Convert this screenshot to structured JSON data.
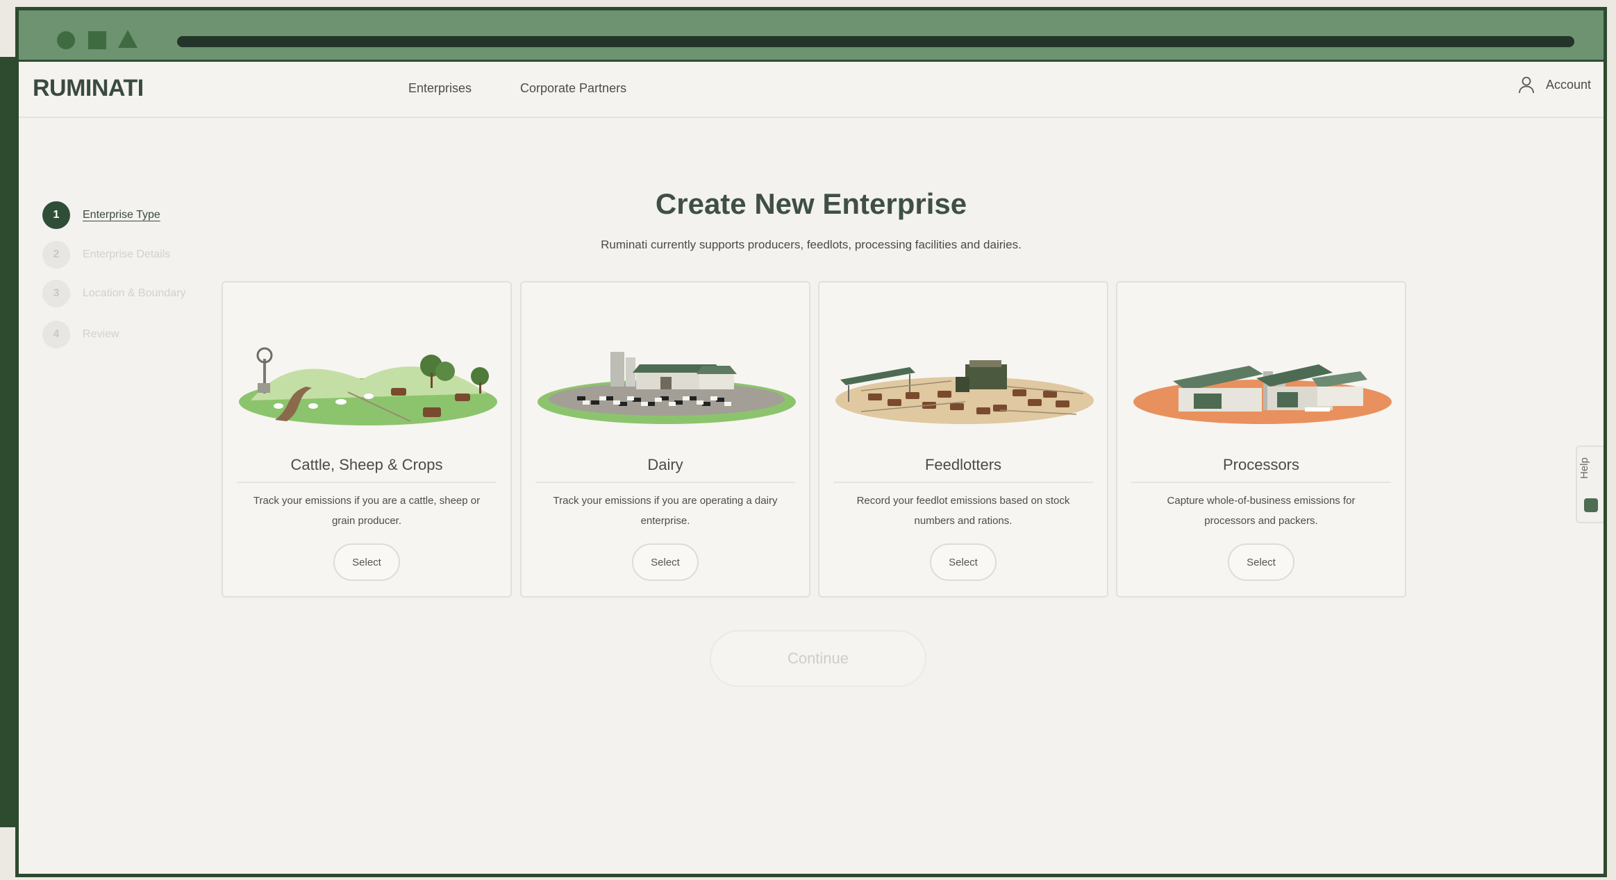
{
  "nav": {
    "logo": "RUMINATI",
    "links": [
      "Enterprises",
      "Corporate Partners"
    ],
    "account_label": "Account"
  },
  "steps": [
    {
      "number": "1",
      "label": "Enterprise Type",
      "state": "active"
    },
    {
      "number": "2",
      "label": "Enterprise Details",
      "state": "inactive"
    },
    {
      "number": "3",
      "label": "Location & Boundary",
      "state": "inactive"
    },
    {
      "number": "4",
      "label": "Review",
      "state": "inactive"
    }
  ],
  "main": {
    "title": "Create New Enterprise",
    "subtitle": "Ruminati currently supports producers, feedlots, processing facilities and dairies."
  },
  "cards": [
    {
      "title": "Cattle, Sheep & Crops",
      "description": "Track your emissions if you are a cattle, sheep or grain producer.",
      "button": "Select",
      "icon": "farm-illustration"
    },
    {
      "title": "Dairy",
      "description": "Track your emissions if you are operating a dairy enterprise.",
      "button": "Select",
      "icon": "dairy-illustration"
    },
    {
      "title": "Feedlotters",
      "description": "Record your feedlot emissions based on stock numbers and rations.",
      "button": "Select",
      "icon": "feedlot-illustration"
    },
    {
      "title": "Processors",
      "description": "Capture whole-of-business emissions for processors and packers.",
      "button": "Select",
      "icon": "processor-illustration"
    }
  ],
  "continue_label": "Continue",
  "help_label": "Help",
  "colors": {
    "frame": "#2d4a2f",
    "chrome": "#6d9371",
    "brand_dark": "#2f4e37",
    "page_bg": "#f3f2ee"
  }
}
